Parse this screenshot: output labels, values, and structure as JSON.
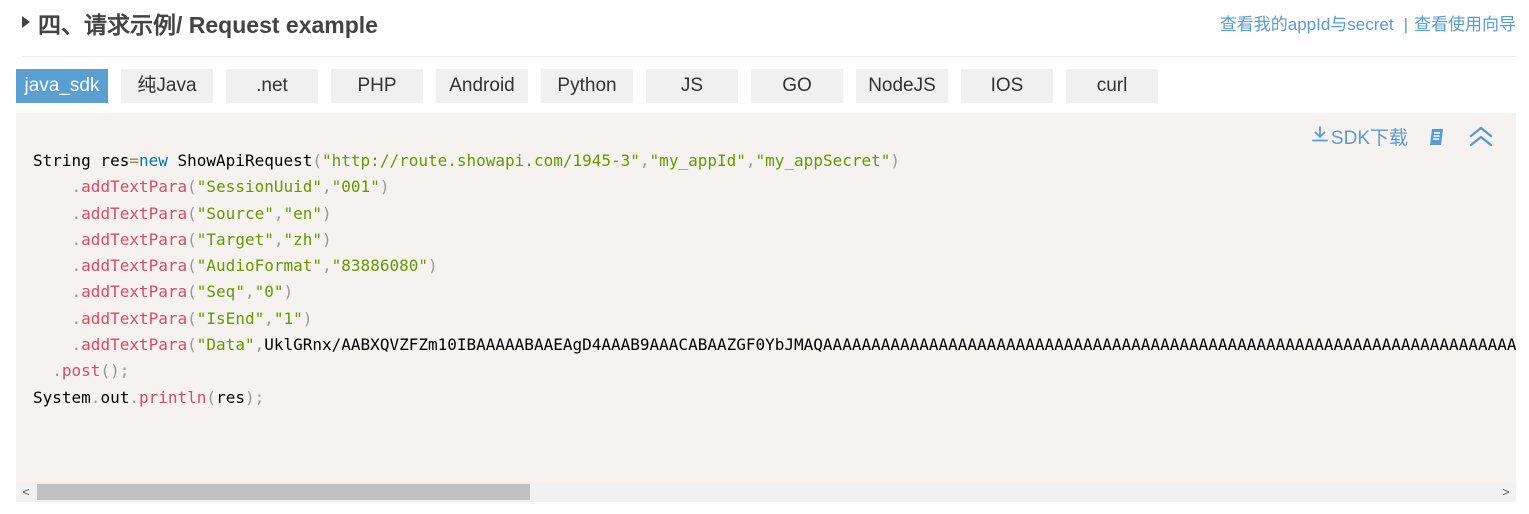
{
  "header": {
    "title": "四、请求示例/ Request example",
    "link_appid": "查看我的appId与secret",
    "separator": "|",
    "link_guide": "查看使用向导"
  },
  "tabs": [
    {
      "label": "java_sdk",
      "active": true
    },
    {
      "label": "纯Java",
      "active": false
    },
    {
      "label": ".net",
      "active": false
    },
    {
      "label": "PHP",
      "active": false
    },
    {
      "label": "Android",
      "active": false
    },
    {
      "label": "Python",
      "active": false
    },
    {
      "label": "JS",
      "active": false
    },
    {
      "label": "GO",
      "active": false
    },
    {
      "label": "NodeJS",
      "active": false
    },
    {
      "label": "IOS",
      "active": false
    },
    {
      "label": "curl",
      "active": false
    }
  ],
  "panel": {
    "sdk_download_label": "SDK下载",
    "icons": [
      "download-icon",
      "copy-icon",
      "collapse-icon"
    ]
  },
  "code": {
    "language": "java",
    "lines": [
      "String res=new ShowApiRequest(\"http://route.showapi.com/1945-3\",\"my_appId\",\"my_appSecret\")",
      "    .addTextPara(\"SessionUuid\",\"001\")",
      "    .addTextPara(\"Source\",\"en\")",
      "    .addTextPara(\"Target\",\"zh\")",
      "    .addTextPara(\"AudioFormat\",\"83886080\")",
      "    .addTextPara(\"Seq\",\"0\")",
      "    .addTextPara(\"IsEnd\",\"1\")",
      "    .addTextPara(\"Data\",\"UklGRnx/AABXQVZFZm10IBAAAAABAAEAgD4AAAB9AAACABAAZGF0YbJMAQAAAAAAAAAAAAAAAAAAAAAAAAAAAAAAAAAAAAAAAAAAAAAAAAAAAAAAAAAAAAAAAAAAAAAAAA",
      "  .post();",
      "System.out.println(res);"
    ]
  },
  "scrollbar": {
    "left_arrow": "<",
    "right_arrow": ">"
  },
  "colors": {
    "accent": "#5a9fd4",
    "link": "#5a9bd5",
    "code_bg": "#f5f2f0",
    "string": "#669900",
    "function": "#dd4a68",
    "keyword": "#0077aa",
    "operator": "#a67f59",
    "punctuation": "#999999"
  }
}
